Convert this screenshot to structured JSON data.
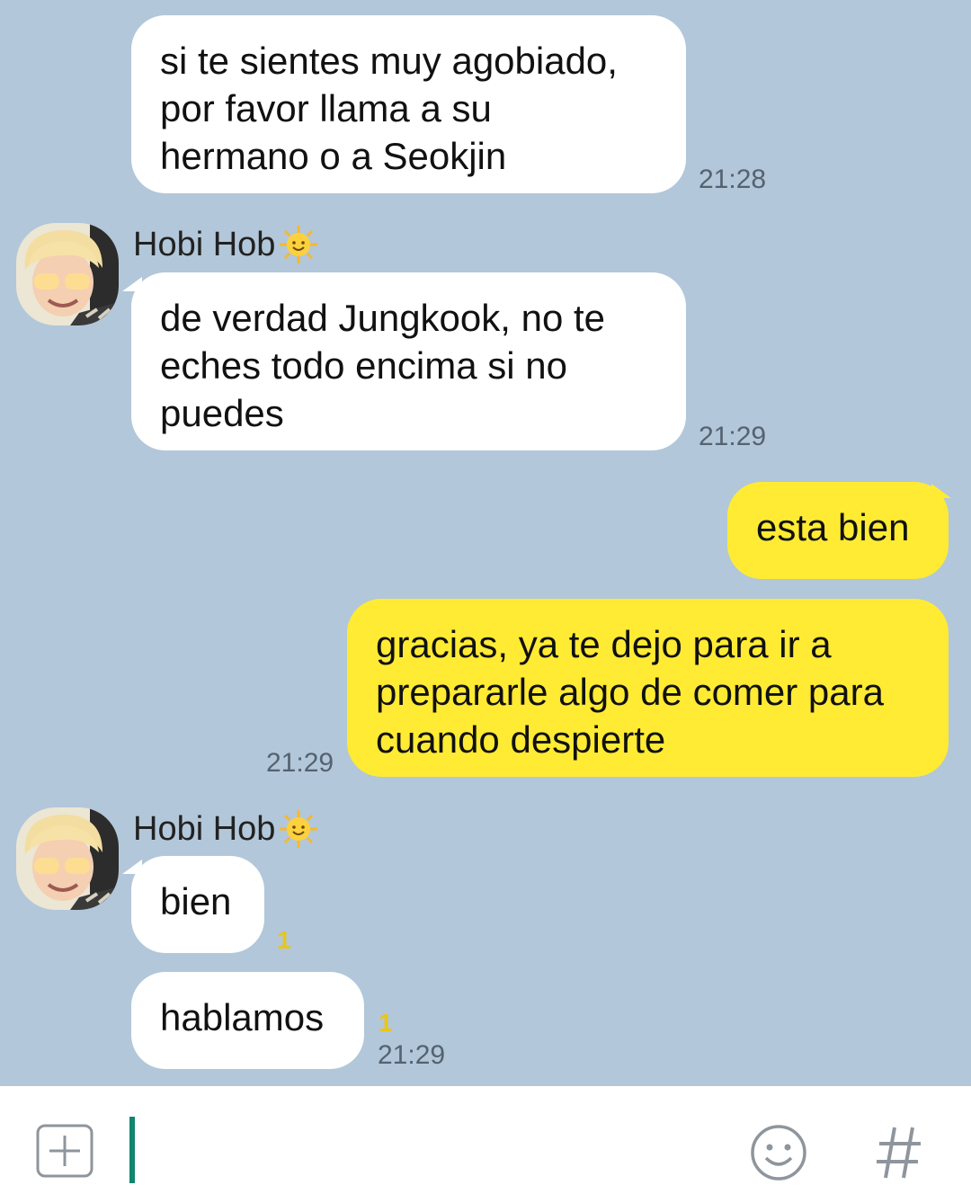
{
  "messages": [
    {
      "text": "si te sientes muy agobiado,\npor favor llama a su\nhermano o a Seokjin",
      "time": "21:28"
    },
    {
      "sender": "Hobi Hob",
      "text": "de verdad Jungkook, no te\neches todo encima si no\npuedes",
      "time": "21:29"
    },
    {
      "text": "esta bien"
    },
    {
      "text": "gracias, ya te dejo para ir a\nprepararle algo de comer para\ncuando despierte",
      "time": "21:29"
    },
    {
      "sender": "Hobi Hob",
      "text": "bien",
      "unread": "1"
    },
    {
      "text": "hablamos",
      "unread": "1",
      "time": "21:29"
    }
  ],
  "colors": {
    "chat_background": "#b2c7d9",
    "incoming_bubble": "#ffffff",
    "outgoing_bubble": "#ffeb33",
    "unread_count": "#e8c51a",
    "cursor": "#10856f"
  },
  "icons": {
    "sender_badge": "sun-emoji-icon",
    "attach": "plus-box-icon",
    "emoji": "smiley-icon",
    "hashtag": "hashtag-icon"
  }
}
